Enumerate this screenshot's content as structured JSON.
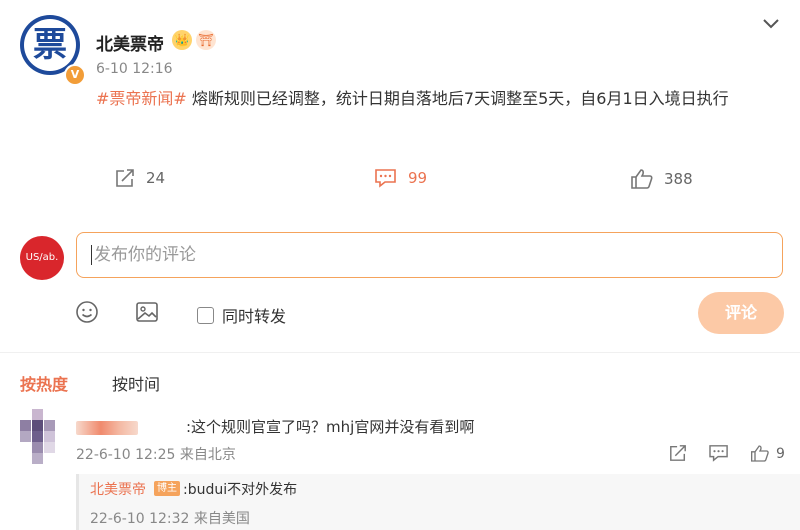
{
  "post": {
    "author": "北美票帝",
    "avatar_glyph": "票",
    "verified_mark": "V",
    "badge1": "👑",
    "badge2": "⛩",
    "time": "6-10 12:16",
    "topic": "#票帝新闻#",
    "text": " 熔断规则已经调整，统计日期自落地后7天调整至5天，自6月1日入境日执行",
    "menu_icon": "chevron-down-icon"
  },
  "actions": {
    "share_count": "24",
    "comment_count": "99",
    "like_count": "388"
  },
  "composer": {
    "avatar_text": "US/ab.",
    "placeholder": "发布你的评论",
    "repost_label": "同时转发",
    "submit_label": "评论"
  },
  "sort_tabs": {
    "hot": "按热度",
    "time": "按时间"
  },
  "comment": {
    "text": ":这个规则官宣了吗？mhj官网并没有看到啊",
    "meta": "22-6-10 12:25 来自北京",
    "like_count": "9",
    "reply": {
      "author": "北美票帝",
      "tag": "博主",
      "text": ":budui不对外发布",
      "meta": "22-6-10 12:32 来自美国"
    }
  },
  "colors": {
    "accent": "#eb7350",
    "brand_blue": "#1e4a9b",
    "button_disabled": "#fcc9a6"
  }
}
